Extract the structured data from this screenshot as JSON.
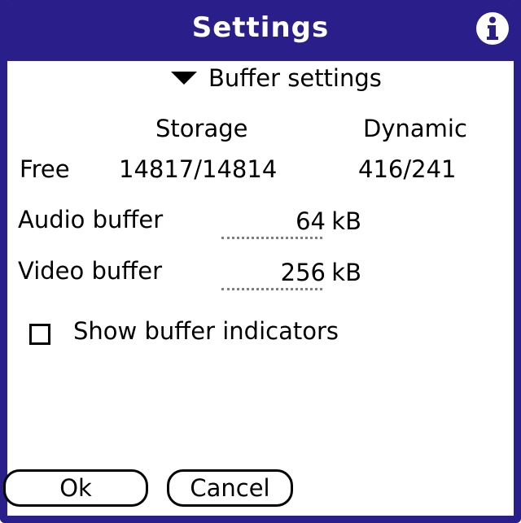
{
  "window": {
    "title": "Settings",
    "info_icon": "info-icon"
  },
  "section": {
    "label": "Buffer settings",
    "expander_icon": "triangle-down-icon"
  },
  "memory": {
    "columns": [
      "Storage",
      "Dynamic"
    ],
    "row_label": "Free",
    "storage_value": "14817/14814",
    "dynamic_value": "416/241"
  },
  "audio_buffer": {
    "label": "Audio buffer",
    "value": "64",
    "unit": "kB"
  },
  "video_buffer": {
    "label": "Video buffer",
    "value": "256",
    "unit": "kB"
  },
  "show_indicators": {
    "label": "Show buffer indicators",
    "checked": false
  },
  "buttons": {
    "ok": "Ok",
    "cancel": "Cancel"
  },
  "colors": {
    "titlebar": "#2a1e8a",
    "background": "#ffffff",
    "text": "#000000"
  }
}
